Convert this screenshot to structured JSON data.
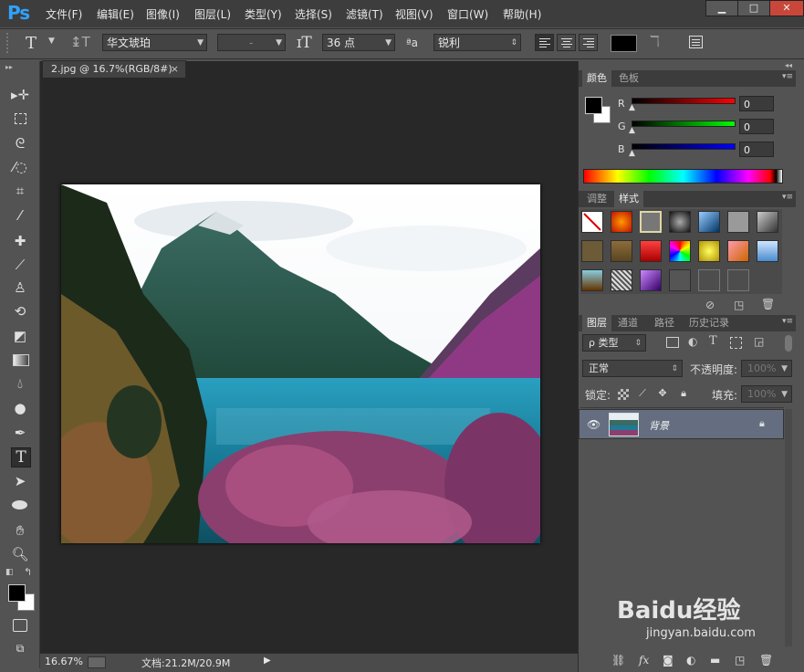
{
  "menubar": {
    "logo": "Ps",
    "items": [
      "文件(F)",
      "编辑(E)",
      "图像(I)",
      "图层(L)",
      "类型(Y)",
      "选择(S)",
      "滤镜(T)",
      "视图(V)",
      "窗口(W)",
      "帮助(H)"
    ],
    "window_buttons": {
      "minimize": "▁",
      "maximize": "□",
      "close": "✕"
    }
  },
  "options": {
    "font_family": "华文琥珀",
    "font_style": "-",
    "font_size": "36 点",
    "aa_label": "ªa",
    "antialias": "锐利"
  },
  "document": {
    "tab_title": "2.jpg @ 16.7%(RGB/8#)",
    "tab_close": "×"
  },
  "status": {
    "zoom": "16.67%",
    "doc_info": "文档:21.2M/20.9M"
  },
  "color_panel": {
    "tabs": [
      "颜色",
      "色板"
    ],
    "channels": [
      {
        "label": "R",
        "value": "0",
        "color": "#ff0000"
      },
      {
        "label": "G",
        "value": "0",
        "color": "#00ff00"
      },
      {
        "label": "B",
        "value": "0",
        "color": "#0000ff"
      }
    ]
  },
  "styles_panel": {
    "tabs": [
      "调整",
      "样式"
    ]
  },
  "layers_panel": {
    "tabs": [
      "图层",
      "通道",
      "路径",
      "历史记录"
    ],
    "filter_label": "ρ 类型",
    "blend_mode": "正常",
    "opacity_label": "不透明度:",
    "opacity_value": "100%",
    "lock_label": "锁定:",
    "fill_label": "填充:",
    "fill_value": "100%",
    "layer_name": "背景"
  },
  "watermark": {
    "brand": "Baidu经验",
    "url": "jingyan.baidu.com"
  },
  "colors": {
    "accent_blue": "#2fa2ff",
    "selected_layer": "#646e80",
    "canvas_bg": "#282828"
  }
}
